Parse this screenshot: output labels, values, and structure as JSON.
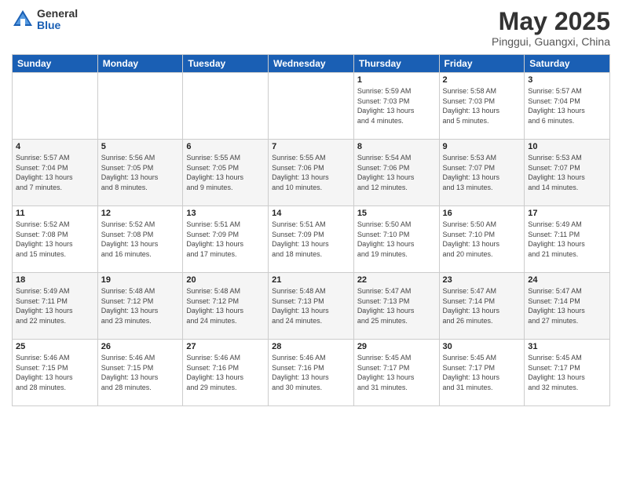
{
  "header": {
    "logo_general": "General",
    "logo_blue": "Blue",
    "month_title": "May 2025",
    "location": "Pinggui, Guangxi, China"
  },
  "weekdays": [
    "Sunday",
    "Monday",
    "Tuesday",
    "Wednesday",
    "Thursday",
    "Friday",
    "Saturday"
  ],
  "weeks": [
    [
      {
        "day": "",
        "info": ""
      },
      {
        "day": "",
        "info": ""
      },
      {
        "day": "",
        "info": ""
      },
      {
        "day": "",
        "info": ""
      },
      {
        "day": "1",
        "info": "Sunrise: 5:59 AM\nSunset: 7:03 PM\nDaylight: 13 hours\nand 4 minutes."
      },
      {
        "day": "2",
        "info": "Sunrise: 5:58 AM\nSunset: 7:03 PM\nDaylight: 13 hours\nand 5 minutes."
      },
      {
        "day": "3",
        "info": "Sunrise: 5:57 AM\nSunset: 7:04 PM\nDaylight: 13 hours\nand 6 minutes."
      }
    ],
    [
      {
        "day": "4",
        "info": "Sunrise: 5:57 AM\nSunset: 7:04 PM\nDaylight: 13 hours\nand 7 minutes."
      },
      {
        "day": "5",
        "info": "Sunrise: 5:56 AM\nSunset: 7:05 PM\nDaylight: 13 hours\nand 8 minutes."
      },
      {
        "day": "6",
        "info": "Sunrise: 5:55 AM\nSunset: 7:05 PM\nDaylight: 13 hours\nand 9 minutes."
      },
      {
        "day": "7",
        "info": "Sunrise: 5:55 AM\nSunset: 7:06 PM\nDaylight: 13 hours\nand 10 minutes."
      },
      {
        "day": "8",
        "info": "Sunrise: 5:54 AM\nSunset: 7:06 PM\nDaylight: 13 hours\nand 12 minutes."
      },
      {
        "day": "9",
        "info": "Sunrise: 5:53 AM\nSunset: 7:07 PM\nDaylight: 13 hours\nand 13 minutes."
      },
      {
        "day": "10",
        "info": "Sunrise: 5:53 AM\nSunset: 7:07 PM\nDaylight: 13 hours\nand 14 minutes."
      }
    ],
    [
      {
        "day": "11",
        "info": "Sunrise: 5:52 AM\nSunset: 7:08 PM\nDaylight: 13 hours\nand 15 minutes."
      },
      {
        "day": "12",
        "info": "Sunrise: 5:52 AM\nSunset: 7:08 PM\nDaylight: 13 hours\nand 16 minutes."
      },
      {
        "day": "13",
        "info": "Sunrise: 5:51 AM\nSunset: 7:09 PM\nDaylight: 13 hours\nand 17 minutes."
      },
      {
        "day": "14",
        "info": "Sunrise: 5:51 AM\nSunset: 7:09 PM\nDaylight: 13 hours\nand 18 minutes."
      },
      {
        "day": "15",
        "info": "Sunrise: 5:50 AM\nSunset: 7:10 PM\nDaylight: 13 hours\nand 19 minutes."
      },
      {
        "day": "16",
        "info": "Sunrise: 5:50 AM\nSunset: 7:10 PM\nDaylight: 13 hours\nand 20 minutes."
      },
      {
        "day": "17",
        "info": "Sunrise: 5:49 AM\nSunset: 7:11 PM\nDaylight: 13 hours\nand 21 minutes."
      }
    ],
    [
      {
        "day": "18",
        "info": "Sunrise: 5:49 AM\nSunset: 7:11 PM\nDaylight: 13 hours\nand 22 minutes."
      },
      {
        "day": "19",
        "info": "Sunrise: 5:48 AM\nSunset: 7:12 PM\nDaylight: 13 hours\nand 23 minutes."
      },
      {
        "day": "20",
        "info": "Sunrise: 5:48 AM\nSunset: 7:12 PM\nDaylight: 13 hours\nand 24 minutes."
      },
      {
        "day": "21",
        "info": "Sunrise: 5:48 AM\nSunset: 7:13 PM\nDaylight: 13 hours\nand 24 minutes."
      },
      {
        "day": "22",
        "info": "Sunrise: 5:47 AM\nSunset: 7:13 PM\nDaylight: 13 hours\nand 25 minutes."
      },
      {
        "day": "23",
        "info": "Sunrise: 5:47 AM\nSunset: 7:14 PM\nDaylight: 13 hours\nand 26 minutes."
      },
      {
        "day": "24",
        "info": "Sunrise: 5:47 AM\nSunset: 7:14 PM\nDaylight: 13 hours\nand 27 minutes."
      }
    ],
    [
      {
        "day": "25",
        "info": "Sunrise: 5:46 AM\nSunset: 7:15 PM\nDaylight: 13 hours\nand 28 minutes."
      },
      {
        "day": "26",
        "info": "Sunrise: 5:46 AM\nSunset: 7:15 PM\nDaylight: 13 hours\nand 28 minutes."
      },
      {
        "day": "27",
        "info": "Sunrise: 5:46 AM\nSunset: 7:16 PM\nDaylight: 13 hours\nand 29 minutes."
      },
      {
        "day": "28",
        "info": "Sunrise: 5:46 AM\nSunset: 7:16 PM\nDaylight: 13 hours\nand 30 minutes."
      },
      {
        "day": "29",
        "info": "Sunrise: 5:45 AM\nSunset: 7:17 PM\nDaylight: 13 hours\nand 31 minutes."
      },
      {
        "day": "30",
        "info": "Sunrise: 5:45 AM\nSunset: 7:17 PM\nDaylight: 13 hours\nand 31 minutes."
      },
      {
        "day": "31",
        "info": "Sunrise: 5:45 AM\nSunset: 7:17 PM\nDaylight: 13 hours\nand 32 minutes."
      }
    ]
  ]
}
